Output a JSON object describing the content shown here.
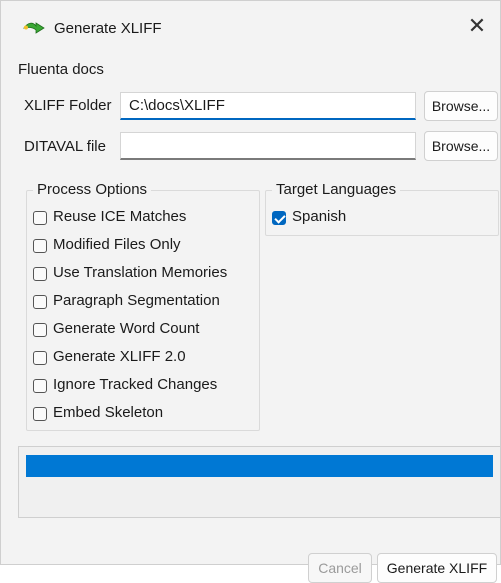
{
  "window": {
    "title": "Generate XLIFF",
    "close_glyph": "✕"
  },
  "project_name": "Fluenta docs",
  "xliff_folder": {
    "label": "XLIFF Folder",
    "value": "C:\\docs\\XLIFF",
    "browse_label": "Browse..."
  },
  "ditaval_file": {
    "label": "DITAVAL file",
    "value": "",
    "browse_label": "Browse..."
  },
  "process_options": {
    "title": "Process Options",
    "items": [
      {
        "label": "Reuse ICE Matches",
        "checked": false
      },
      {
        "label": "Modified Files Only",
        "checked": false
      },
      {
        "label": "Use Translation Memories",
        "checked": false
      },
      {
        "label": "Paragraph Segmentation",
        "checked": false
      },
      {
        "label": "Generate Word Count",
        "checked": false
      },
      {
        "label": "Generate XLIFF 2.0",
        "checked": false
      },
      {
        "label": "Ignore Tracked Changes",
        "checked": false
      },
      {
        "label": "Embed Skeleton",
        "checked": false
      }
    ]
  },
  "target_languages": {
    "title": "Target Languages",
    "items": [
      {
        "label": "Spanish",
        "checked": true
      }
    ]
  },
  "progress": {
    "value": 1.0,
    "color": "#0078d4"
  },
  "buttons": {
    "cancel_label": "Cancel",
    "generate_label": "Generate XLIFF"
  },
  "icons": {
    "app": "green-arrow-icon",
    "close": "close-icon"
  }
}
